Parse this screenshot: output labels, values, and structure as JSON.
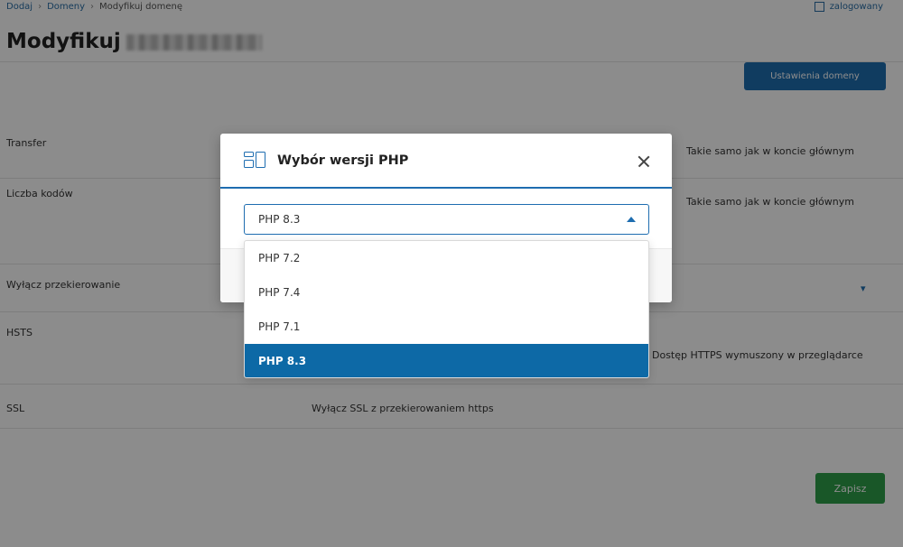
{
  "background": {
    "breadcrumb": [
      "Dodaj",
      "Domeny",
      "Modyfikuj domenę"
    ],
    "account": "zalogowany",
    "title": "Modyfikuj",
    "top_button": "Ustawienia domeny",
    "rows": [
      {
        "label": "Transfer",
        "value": "Takie samo jak w koncie głównym"
      },
      {
        "label": "Liczba kodów",
        "value": "Takie samo jak w koncie głównym"
      },
      {
        "label": "Wyłącz przekierowanie",
        "value": ""
      },
      {
        "label": "HSTS",
        "value": "Dostęp HTTPS wymuszony w przeglądarce"
      },
      {
        "label": "SSL",
        "value": "Wyłącz SSL z przekierowaniem https"
      }
    ],
    "save_button": "Zapisz"
  },
  "modal": {
    "title": "Wybór wersji PHP",
    "icon": "layout-icon",
    "select": {
      "value": "PHP 8.3"
    },
    "options": [
      "PHP 7.2",
      "PHP 7.4",
      "PHP 7.1",
      "PHP 8.3"
    ],
    "selected_option": "PHP 8.3",
    "accent_color": "#1e6db0",
    "selected_bg": "#0d69a6"
  }
}
